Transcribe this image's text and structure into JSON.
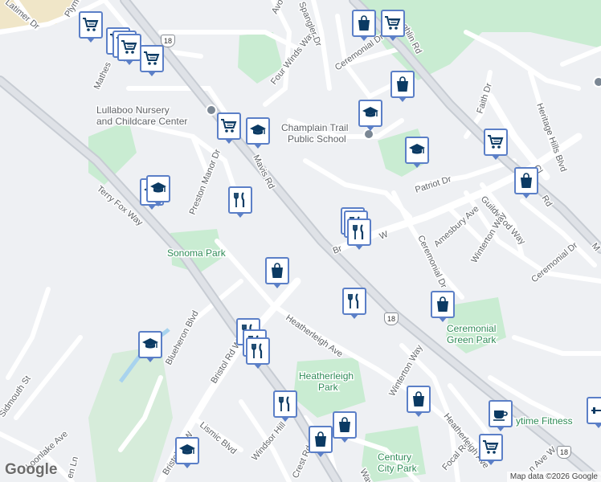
{
  "map": {
    "colors": {
      "background": "#eef0f3",
      "road": "#ffffff",
      "highway": "#c7ccd3",
      "park": "#bfe6c8",
      "marker_border": "#5b7fc7",
      "icon": "#0b3a63"
    },
    "road_labels": [
      "Mavis Rd",
      "Terry Fox Way",
      "Bristol Rd W",
      "Bristol Rd W",
      "Heatherleigh Ave",
      "Ceremonial Dr",
      "Ceremonial Dr",
      "Ceremonial Dr",
      "Preston Manor Dr",
      "Four Winds Way",
      "Mathes",
      "Plymo",
      "Latimer Dr",
      "Avo",
      "Spangler Dr",
      "ghlin Rd",
      "Patriot Dr",
      "Guildwood Way",
      "Amesbury Ave",
      "Winterton Way",
      "Winterton Way",
      "Faith Dr",
      "Heritage Hills Blvd",
      "Sidmouth St",
      "Loonlake Ave",
      "Blueheron Blvd",
      "Lismic Blvd",
      "Windsor Hill",
      "Focal Rd",
      "Heatherleigh Ave",
      "Ta",
      "Cl",
      "Rd",
      "Br",
      "W",
      "M",
      "Crest Rd",
      "n Ave W",
      "en Ln",
      "Way"
    ],
    "poi_labels": [
      "Lullaboo Nursery",
      "and Childcare Center",
      "Champlain Trail",
      "Public School"
    ],
    "park_labels": [
      "Sonoma Park",
      "Heatherleigh",
      "Park",
      "Ceremonial",
      "Green Park",
      "Century",
      "City Park",
      "ytime Fitness"
    ],
    "shields": [
      "18",
      "18",
      "18"
    ],
    "markers": [
      {
        "icon": "shopping-cart-icon"
      },
      {
        "icon": "shopping-cart-icon"
      },
      {
        "icon": "shopping-cart-icon"
      },
      {
        "icon": "shopping-cart-icon"
      },
      {
        "icon": "shopping-cart-icon"
      },
      {
        "icon": "shopping-bag-icon"
      },
      {
        "icon": "shopping-cart-icon"
      },
      {
        "icon": "shopping-bag-icon"
      },
      {
        "icon": "school-icon"
      },
      {
        "icon": "shopping-cart-icon"
      },
      {
        "icon": "school-icon"
      },
      {
        "icon": "school-icon"
      },
      {
        "icon": "shopping-cart-icon"
      },
      {
        "icon": "shopping-bag-icon"
      },
      {
        "icon": "school-icon"
      },
      {
        "icon": "school-icon"
      },
      {
        "icon": "restaurant-icon"
      },
      {
        "icon": "restaurant-icon"
      },
      {
        "icon": "restaurant-icon"
      },
      {
        "icon": "restaurant-icon"
      },
      {
        "icon": "shopping-bag-icon"
      },
      {
        "icon": "restaurant-icon"
      },
      {
        "icon": "shopping-bag-icon"
      },
      {
        "icon": "school-icon"
      },
      {
        "icon": "restaurant-icon"
      },
      {
        "icon": "restaurant-icon"
      },
      {
        "icon": "restaurant-icon"
      },
      {
        "icon": "restaurant-icon"
      },
      {
        "icon": "shopping-bag-icon"
      },
      {
        "icon": "shopping-bag-icon"
      },
      {
        "icon": "shopping-bag-icon"
      },
      {
        "icon": "cafe-icon"
      },
      {
        "icon": "shopping-cart-icon"
      },
      {
        "icon": "school-icon"
      },
      {
        "icon": "fitness-icon"
      }
    ],
    "logo": "Google",
    "attribution": "Map data ©2026 Google"
  }
}
